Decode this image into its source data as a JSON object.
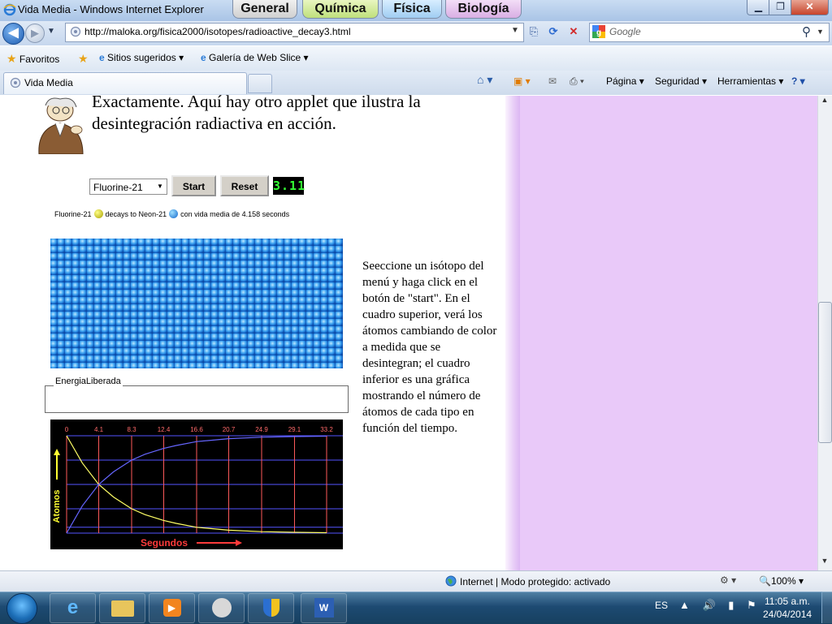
{
  "window": {
    "title": "Vida Media - Windows Internet Explorer",
    "site_tabs": [
      "General",
      "Química",
      "Física",
      "Biología"
    ],
    "min_label": "▁",
    "max_label": "❐",
    "close_label": "✕"
  },
  "address": {
    "url": "http://maloka.org/fisica2000/isotopes/radioactive_decay3.html",
    "search_placeholder": "Google"
  },
  "favorites": {
    "favorites_label": "Favoritos",
    "suggested_label": "Sitios sugeridos ▾",
    "webslice_label": "Galería de Web Slice ▾"
  },
  "tab": {
    "label": "Vida Media"
  },
  "command_bar": {
    "page_label": "Página ▾",
    "security_label": "Seguridad ▾",
    "tools_label": "Herramientas ▾",
    "help_label": "? ▾"
  },
  "content": {
    "intro": "Exactamente. Aquí hay otro applet que ilustra la desintegración radiactiva en acción.",
    "isotope_selected": "Fluorine-21",
    "start_label": "Start",
    "reset_label": "Reset",
    "counter": "3.11",
    "legend_a": "Fluorine-21",
    "legend_b": "decays to Neon-21",
    "legend_c": "con vida media de 4.158 seconds",
    "energy_label": "EnergiaLiberada",
    "description": "Seeccione un isótopo del menú y haga click en el botón de \"start\". En el cuadro superior, verá los átomos cambiando de color a medida que se desintegran; el cuadro inferior es una gráfica mostrando el número de átomos de cada tipo en función del tiempo."
  },
  "chart_data": {
    "type": "line",
    "title": "",
    "xlabel": "Segundos",
    "ylabel": "Atomos",
    "x_ticks": [
      "0",
      "4.1",
      "8.3",
      "12.4",
      "16.6",
      "20.7",
      "24.9",
      "29.1",
      "33.2"
    ],
    "xlim": [
      0,
      33.2
    ],
    "ylim": [
      0,
      100
    ],
    "series": [
      {
        "color": "#ffff66",
        "x": [
          0,
          2,
          4.1,
          6,
          8.3,
          10,
          12.4,
          14,
          16.6,
          20.7,
          24.9,
          29.1,
          33.2
        ],
        "values": [
          100,
          72,
          50,
          37,
          25,
          19,
          13,
          10,
          6,
          3,
          1.5,
          0.8,
          0.4
        ]
      },
      {
        "color": "#6666ff",
        "x": [
          0,
          2,
          4.1,
          6,
          8.3,
          10,
          12.4,
          14,
          16.6,
          20.7,
          24.9,
          29.1,
          33.2
        ],
        "values": [
          0,
          28,
          50,
          63,
          75,
          81,
          87,
          90,
          94,
          97,
          98.5,
          99.2,
          99.6
        ]
      }
    ],
    "vertical_grid_color": "#ff5a5a",
    "horizontal_grid_color": "#5555ff",
    "grid": true
  },
  "status": {
    "zone": "Internet | Modo protegido: activado",
    "zoom": "100%"
  },
  "taskbar": {
    "language": "ES",
    "time": "11:05 a.m.",
    "date": "24/04/2014"
  },
  "colors": {
    "lavender_panel": "#e9c9f9",
    "atom_blue": "#1a6fd0",
    "counter_green": "#35ff35"
  }
}
